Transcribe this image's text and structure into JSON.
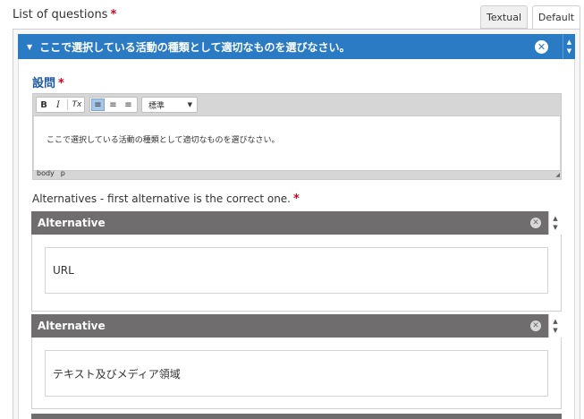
{
  "header": {
    "list_label": "List of questions",
    "required_mark": "*",
    "tabs": [
      {
        "label": "Textual",
        "active": false
      },
      {
        "label": "Default",
        "active": true
      }
    ]
  },
  "question": {
    "title": "ここで選択している活動の種類として適切なものを選びなさい。",
    "collapse_glyph": "▼",
    "close_glyph": "✕",
    "up_glyph": "▲",
    "down_glyph": "▼",
    "field_label": "設問",
    "editor": {
      "toolbar": {
        "bold": "B",
        "italic": "I",
        "remove_format": "Tx",
        "align_left": "≡",
        "align_center": "≡",
        "align_right": "≡"
      },
      "format_value": "標準",
      "content": "ここで選択している活動の種類として適切なものを選びなさい。",
      "status_path": [
        "body",
        "p"
      ]
    }
  },
  "alternatives": {
    "label": "Alternatives - first alternative is the correct one.",
    "items": [
      {
        "header": "Alternative",
        "value": "URL"
      },
      {
        "header": "Alternative",
        "value": "テキスト及びメディア領域"
      }
    ]
  },
  "colors": {
    "question_header": "#2a7bc4",
    "alternative_header": "#6f6d6d",
    "required": "#d0021b",
    "field_label": "#1f5aa0"
  }
}
